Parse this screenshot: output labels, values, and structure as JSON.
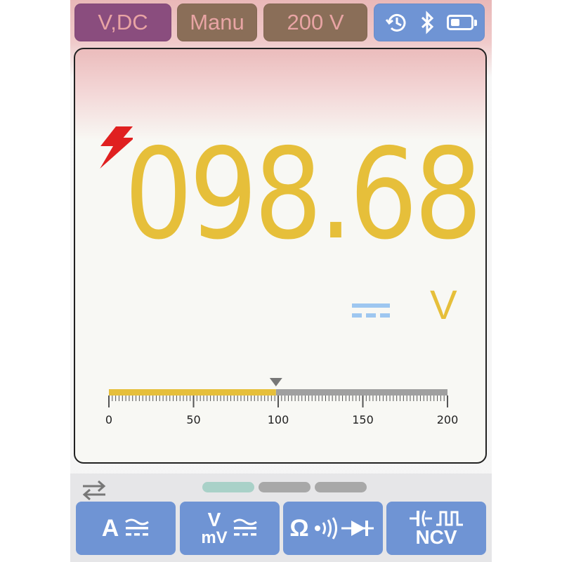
{
  "status_bar": {
    "mode": "V,DC",
    "range_mode": "Manu",
    "range": "200 V",
    "icons": [
      "history-clock-icon",
      "bluetooth-icon",
      "battery-icon"
    ],
    "battery_level": 0.45
  },
  "display": {
    "reading": "098.68",
    "unit": "V",
    "coupling_icon": "dc-symbol-icon",
    "warning_icon": "lightning-bolt-icon"
  },
  "scale": {
    "min": 0,
    "max": 200,
    "value": 98.68,
    "labels": [
      "0",
      "50",
      "100",
      "150",
      "200"
    ]
  },
  "colors": {
    "reading": "#e6bf3a",
    "scale_fill": "#e6bf3a",
    "scale_track": "#a0a0a0",
    "button": "#6f94d4",
    "bolt": "#e02020"
  },
  "pager": {
    "pages": 3,
    "active": 0
  },
  "function_buttons": [
    {
      "id": "amps",
      "label": "A",
      "icon": "ac-dc-icon"
    },
    {
      "id": "volts",
      "label_top": "V",
      "label_bottom": "mV",
      "icon": "ac-dc-icon"
    },
    {
      "id": "ohms",
      "label": "Ω",
      "icon": "continuity-diode-icon"
    },
    {
      "id": "cap-ncv",
      "label": "NCV",
      "icon": "capacitor-pulse-icon"
    }
  ]
}
